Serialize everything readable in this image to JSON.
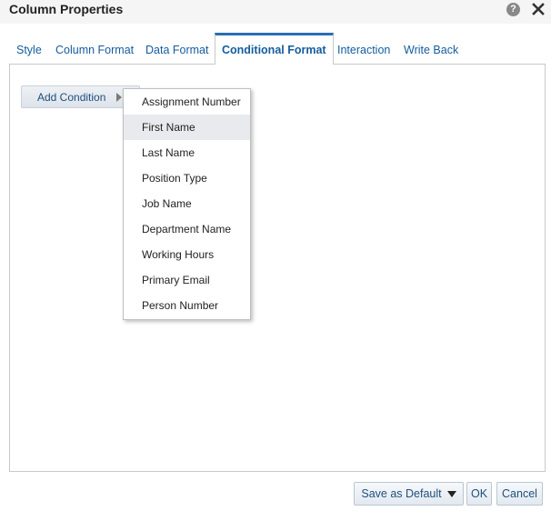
{
  "window": {
    "title": "Column Properties",
    "help_icon": "question-circle-icon",
    "help_glyph": "?",
    "close_icon": "close-icon"
  },
  "tabs": [
    {
      "label": "Style"
    },
    {
      "label": "Column Format"
    },
    {
      "label": "Data Format"
    },
    {
      "label": "Conditional Format",
      "active": true
    },
    {
      "label": "Interaction"
    },
    {
      "label": "Write Back"
    }
  ],
  "toolbar": {
    "add_condition_label": "Add Condition",
    "add_condition_icon": "arrow-right-icon"
  },
  "menu": {
    "items": [
      {
        "label": "Assignment Number"
      },
      {
        "label": "First Name",
        "highlighted": true
      },
      {
        "label": "Last Name"
      },
      {
        "label": "Position Type"
      },
      {
        "label": "Job Name"
      },
      {
        "label": "Department Name"
      },
      {
        "label": "Working Hours"
      },
      {
        "label": "Primary Email"
      },
      {
        "label": "Person Number"
      }
    ]
  },
  "footer": {
    "save_default_label": "Save as Default",
    "ok_label": "OK",
    "cancel_label": "Cancel"
  },
  "colors": {
    "accent": "#2a6eb5",
    "link": "#145c9e",
    "menu_highlight": "#e8eaed"
  }
}
